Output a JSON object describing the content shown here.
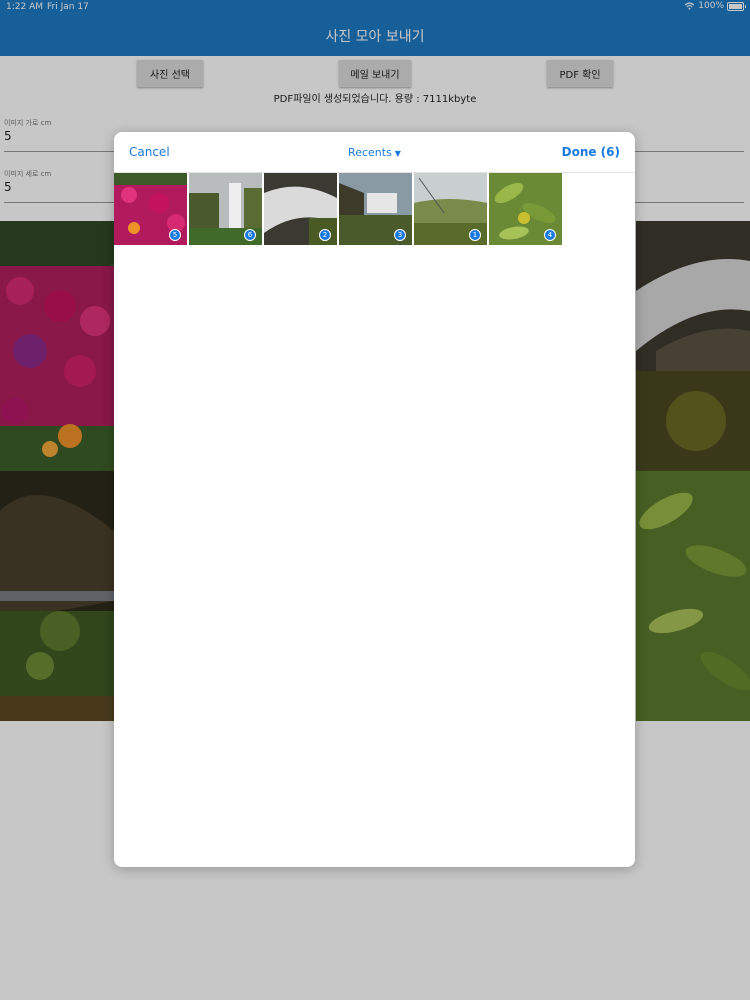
{
  "status": {
    "time": "1:22 AM",
    "date": "Fri Jan 17",
    "battery": "100%"
  },
  "app": {
    "title": "사진 모아 보내기"
  },
  "toolbar": {
    "select_label": "사진 선택",
    "mail_label": "메일 보내기",
    "pdf_label": "PDF 확인"
  },
  "info": "PDF파일이 생성되었습니다. 용량 : 7111kbyte",
  "fields": {
    "width": {
      "label": "이미지 가로 cm",
      "value": "5"
    },
    "height": {
      "label": "이미지 세로 cm",
      "value": "5"
    }
  },
  "picker": {
    "cancel": "Cancel",
    "album": "Recents",
    "done": "Done (6)",
    "thumbnails": [
      {
        "subject": "pink flowers",
        "order": "5"
      },
      {
        "subject": "waterfall",
        "order": "6"
      },
      {
        "subject": "stream",
        "order": "2"
      },
      {
        "subject": "wide waterfall",
        "order": "3"
      },
      {
        "subject": "grass field",
        "order": "1"
      },
      {
        "subject": "leaves",
        "order": "4"
      }
    ]
  },
  "colors": {
    "app_bar": "#1e7ac4",
    "accent": "#1a7ae0"
  }
}
